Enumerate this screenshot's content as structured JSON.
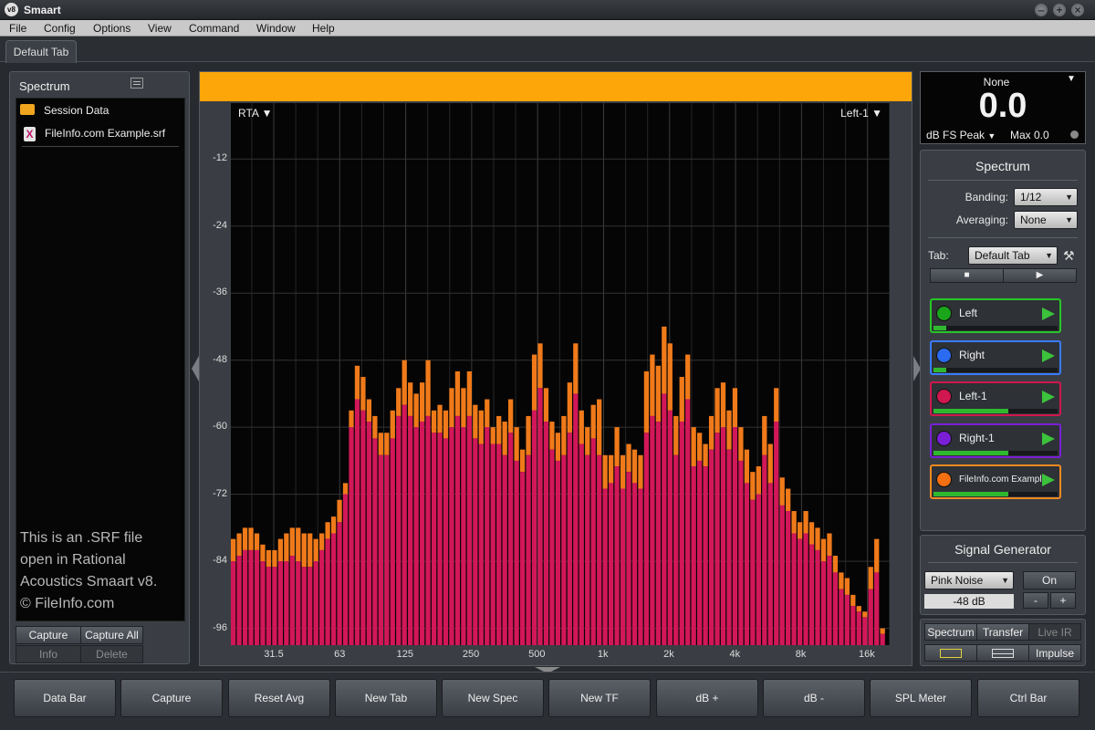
{
  "app": {
    "logo_text": "v8",
    "title": "Smaart",
    "window_buttons": [
      "–",
      "+",
      "×"
    ]
  },
  "menu": [
    "File",
    "Config",
    "Options",
    "View",
    "Command",
    "Window",
    "Help"
  ],
  "tabs": [
    {
      "label": "Default Tab",
      "active": true
    }
  ],
  "left_panel": {
    "title": "Spectrum",
    "tree": [
      {
        "label": "Session Data",
        "icon": "folder-icon"
      },
      {
        "label": "FileInfo.com Example.srf",
        "icon": "srf-file-icon",
        "icon_glyph": "X"
      }
    ],
    "watermark_lines": [
      "This is an .SRF file",
      "open in Rational",
      "Acoustics Smaart v8.",
      "© FileInfo.com"
    ],
    "buttons": {
      "capture": "Capture",
      "capture_all": "Capture All",
      "info": "Info",
      "delete": "Delete"
    }
  },
  "graph": {
    "data_bar_color": "#fca60a",
    "mode_label": "RTA ▼",
    "trace_label": "Left-1 ▼"
  },
  "chart_data": {
    "type": "bar",
    "title": "",
    "xlabel": "",
    "ylabel": "",
    "x_scale": "log (1/12 octave bands)",
    "x_ticks": [
      "31.5",
      "63",
      "125",
      "250",
      "500",
      "1k",
      "2k",
      "4k",
      "8k",
      "16k"
    ],
    "y_ticks": [
      -12,
      -24,
      -36,
      -48,
      -60,
      -72,
      -84,
      -96
    ],
    "ylim": [
      -99,
      -2
    ],
    "grid": true,
    "bar_color": "#d21758",
    "peak_color": "#f07a1a",
    "series": [
      {
        "values": [
          -84,
          -83,
          -82,
          -82,
          -82,
          -84,
          -85,
          -85,
          -84,
          -84,
          -83,
          -84,
          -85,
          -85,
          -84,
          -82,
          -80,
          -79,
          -77,
          -72,
          -60,
          -55,
          -57,
          -59,
          -62,
          -65,
          -65,
          -62,
          -58,
          -56,
          -58,
          -60,
          -59,
          -58,
          -61,
          -61,
          -62,
          -60,
          -58,
          -60,
          -58,
          -62,
          -63,
          -60,
          -63,
          -63,
          -65,
          -61,
          -66,
          -68,
          -65,
          -57,
          -53,
          -59,
          -64,
          -66,
          -65,
          -61,
          -54,
          -63,
          -65,
          -62,
          -65,
          -71,
          -70,
          -67,
          -71,
          -68,
          -70,
          -71,
          -61,
          -58,
          -59,
          -54,
          -57,
          -65,
          -59,
          -55,
          -67,
          -66,
          -67,
          -64,
          -61,
          -60,
          -64,
          -60,
          -66,
          -70,
          -73,
          -72,
          -65,
          -70,
          -59,
          -74,
          -75,
          -79,
          -80,
          -79,
          -81,
          -82,
          -84,
          -83,
          -86,
          -89,
          -90,
          -92,
          -93,
          -94,
          -89,
          -86,
          -97
        ],
        "peaks": [
          -80,
          -79,
          -78,
          -78,
          -79,
          -81,
          -82,
          -82,
          -80,
          -79,
          -78,
          -78,
          -79,
          -79,
          -80,
          -79,
          -77,
          -76,
          -73,
          -70,
          -57,
          -49,
          -51,
          -55,
          -58,
          -61,
          -61,
          -57,
          -53,
          -48,
          -52,
          -54,
          -52,
          -48,
          -57,
          -56,
          -57,
          -53,
          -50,
          -53,
          -50,
          -56,
          -57,
          -55,
          -60,
          -58,
          -59,
          -55,
          -60,
          -64,
          -58,
          -47,
          -45,
          -53,
          -59,
          -61,
          -58,
          -52,
          -45,
          -57,
          -60,
          -56,
          -55,
          -65,
          -65,
          -60,
          -65,
          -63,
          -64,
          -65,
          -50,
          -47,
          -49,
          -42,
          -45,
          -58,
          -51,
          -47,
          -60,
          -61,
          -63,
          -58,
          -53,
          -52,
          -57,
          -53,
          -60,
          -64,
          -68,
          -67,
          -58,
          -63,
          -53,
          -69,
          -71,
          -75,
          -77,
          -75,
          -77,
          -78,
          -80,
          -79,
          -83,
          -86,
          -87,
          -90,
          -92,
          -93,
          -85,
          -80,
          -96
        ]
      }
    ]
  },
  "meter": {
    "source": "None",
    "value": "0.0",
    "type": "dB FS Peak",
    "max": "Max 0.0"
  },
  "spectrum_panel": {
    "title": "Spectrum",
    "banding_label": "Banding:",
    "banding_value": "1/12",
    "averaging_label": "Averaging:",
    "averaging_value": "None",
    "tab_label": "Tab:",
    "tab_value": "Default Tab",
    "stop_glyph": "■",
    "play_glyph": "▶",
    "channels": [
      {
        "name": "Left",
        "color": "#1aa51a",
        "border": "#27c627",
        "level": 0.1
      },
      {
        "name": "Right",
        "color": "#2a6bf2",
        "border": "#3a7bff",
        "level": 0.1
      },
      {
        "name": "Left-1",
        "color": "#d0174f",
        "border": "#d0174f",
        "level": 0.6
      },
      {
        "name": "Right-1",
        "color": "#7a1fd6",
        "border": "#7a1fd6",
        "level": 0.6
      },
      {
        "name": "FileInfo.com Example",
        "color": "#f26f12",
        "border": "#f08a20",
        "level": 0.6
      }
    ]
  },
  "signal_generator": {
    "title": "Signal Generator",
    "type": "Pink Noise",
    "on_label": "On",
    "level": "-48 dB",
    "minus": "-",
    "plus": "+"
  },
  "modes": {
    "spectrum": "Spectrum",
    "transfer": "Transfer",
    "live_ir": "Live IR",
    "impulse": "Impulse"
  },
  "command_bar": [
    "Data Bar",
    "Capture",
    "Reset Avg",
    "New Tab",
    "New Spec",
    "New TF",
    "dB +",
    "dB -",
    "SPL Meter",
    "Ctrl Bar"
  ]
}
